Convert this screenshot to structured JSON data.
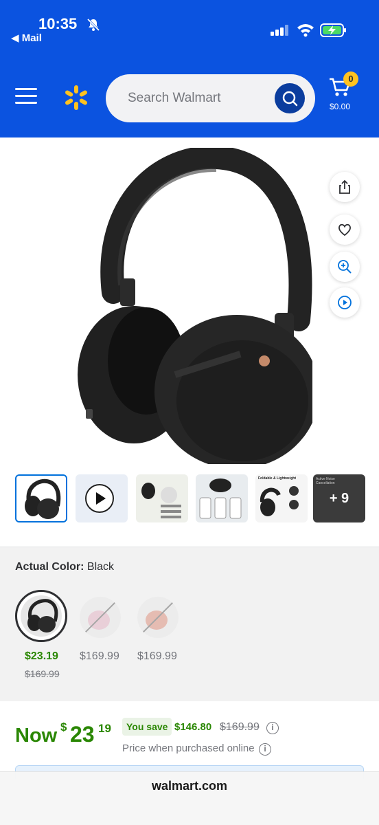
{
  "status_bar": {
    "time": "10:35",
    "back_label": "◀ Mail"
  },
  "header": {
    "search_placeholder": "Search Walmart",
    "cart_count": "0",
    "cart_total": "$0.00"
  },
  "colors": {
    "brand_blue": "#0b53e0",
    "spark_yellow": "#ffc220",
    "price_green": "#2a8703"
  },
  "gallery": {
    "more_count": "+ 9",
    "thumb1_text": "Foldable & Lightweight",
    "thumb2_text": "Active Noise Cancellation"
  },
  "color_selector": {
    "label": "Actual Color:",
    "selected": "Black",
    "options": [
      {
        "price": "$23.19",
        "was": "$169.99"
      },
      {
        "price": "$169.99"
      },
      {
        "price": "$169.99"
      }
    ]
  },
  "price": {
    "now_label": "Now",
    "currency": "$",
    "dollars": "23",
    "cents": "19",
    "you_save_label": "You save",
    "save_amount": "$146.80",
    "was": "$169.99",
    "note": "Price when purchased online"
  },
  "browser": {
    "url": "walmart.com"
  }
}
